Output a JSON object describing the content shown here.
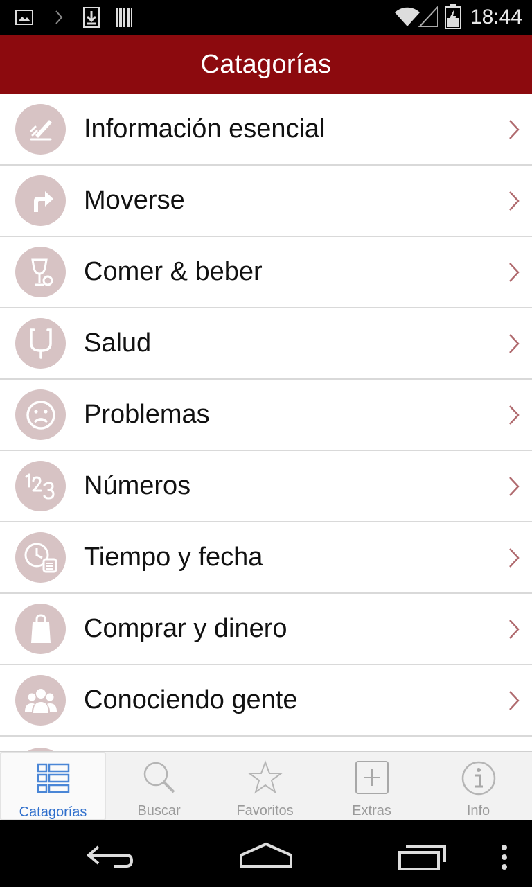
{
  "status_bar": {
    "time": "18:44",
    "icons": [
      "image-icon",
      "chevron-right-icon",
      "download-icon",
      "barcode-icon",
      "wifi-icon",
      "signal-icon",
      "battery-charging-icon"
    ]
  },
  "header": {
    "title": "Catagorías"
  },
  "categories": [
    {
      "label": "Información esencial",
      "icon": "pencil-icon"
    },
    {
      "label": "Moverse",
      "icon": "turn-right-arrow-icon"
    },
    {
      "label": "Comer & beber",
      "icon": "glass-bottle-icon"
    },
    {
      "label": "Salud",
      "icon": "stethoscope-icon"
    },
    {
      "label": "Problemas",
      "icon": "sad-face-icon"
    },
    {
      "label": "Números",
      "icon": "numbers-123-icon"
    },
    {
      "label": "Tiempo y fecha",
      "icon": "clock-calendar-icon"
    },
    {
      "label": "Comprar y dinero",
      "icon": "shopping-bag-icon"
    },
    {
      "label": "Conociendo gente",
      "icon": "people-icon"
    }
  ],
  "tabs": [
    {
      "label": "Catagorías",
      "icon": "list-icon",
      "active": true
    },
    {
      "label": "Buscar",
      "icon": "search-icon",
      "active": false
    },
    {
      "label": "Favoritos",
      "icon": "star-icon",
      "active": false
    },
    {
      "label": "Extras",
      "icon": "plus-box-icon",
      "active": false
    },
    {
      "label": "Info",
      "icon": "info-icon",
      "active": false
    }
  ],
  "colors": {
    "header_bg": "#8c0a0e",
    "icon_circle": "#d7c3c4",
    "chevron": "#b06a6e",
    "active_tab_label": "#2f6fcc"
  }
}
